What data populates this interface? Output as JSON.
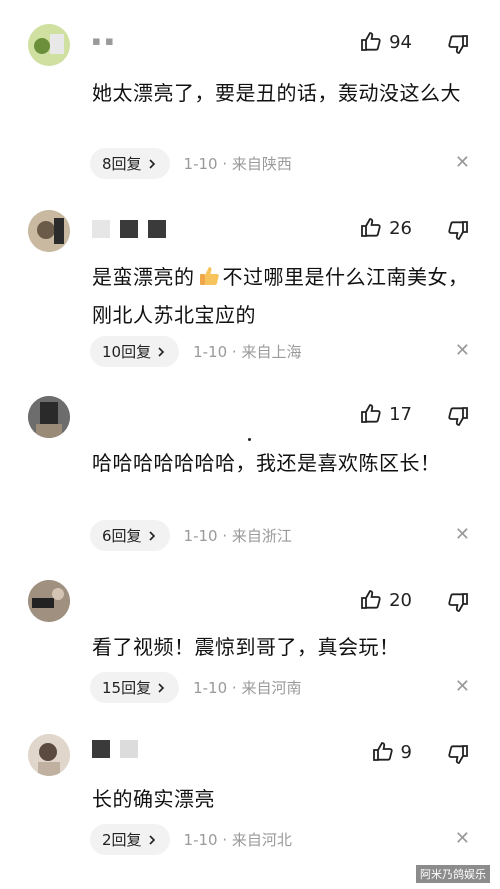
{
  "comments": [
    {
      "username": "▪ ▪",
      "likes": "94",
      "text": "她太漂亮了，要是丑的话，轰动没这么大",
      "reply_count": "8回复",
      "date_location": "1-10 · 来自陕西"
    },
    {
      "username": "",
      "likes": "26",
      "text_before": "是蛮漂亮的",
      "text_after": "不过哪里是什么江南美女，刚北人苏北宝应的",
      "reply_count": "10回复",
      "date_location": "1-10 · 来自上海"
    },
    {
      "username": "",
      "likes": "17",
      "text": "哈哈哈哈哈哈哈，我还是喜欢陈区长！",
      "reply_count": "6回复",
      "date_location": "1-10 · 来自浙江"
    },
    {
      "username": "",
      "likes": "20",
      "text": "看了视频！震惊到哥了，真会玩！",
      "reply_count": "15回复",
      "date_location": "1-10 · 来自河南"
    },
    {
      "username": "",
      "likes": "9",
      "text": "长的确实漂亮",
      "reply_count": "2回复",
      "date_location": "1-10 · 来自河北"
    }
  ],
  "watermark": "阿米乃鸽娱乐",
  "icons": {
    "like": "thumb-up-icon",
    "dislike": "thumb-down-icon",
    "close": "close-icon",
    "chevron": "chevron-right-icon"
  }
}
